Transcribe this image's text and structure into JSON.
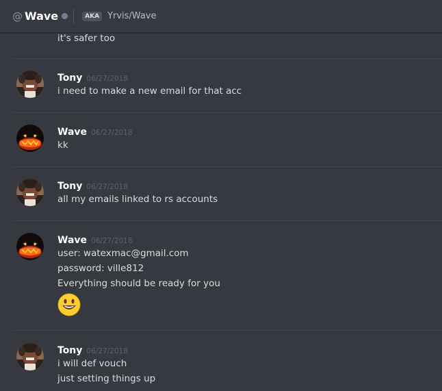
{
  "header": {
    "at": "@",
    "username": "Wave",
    "aka_badge": "AKA",
    "aka_names": "Yrvis/Wave"
  },
  "continuation": {
    "text": "it's safer too"
  },
  "messages": [
    {
      "author": "Tony",
      "timestamp": "06/27/2018",
      "lines": [
        "i need to make a new email for that acc"
      ],
      "avatar": "tony-avatar"
    },
    {
      "author": "Wave",
      "timestamp": "06/27/2018",
      "lines": [
        "kk"
      ],
      "avatar": "wave-avatar"
    },
    {
      "author": "Tony",
      "timestamp": "06/27/2018",
      "lines": [
        "all my emails linked to rs accounts"
      ],
      "avatar": "tony-avatar"
    },
    {
      "author": "Wave",
      "timestamp": "06/27/2018",
      "lines": [
        "user: watexmac@gmail.com",
        "password: ville812",
        "Everything should be ready for you"
      ],
      "emoji": "smiley-emoji",
      "avatar": "wave-avatar"
    },
    {
      "author": "Tony",
      "timestamp": "06/27/2018",
      "lines": [
        "i will def vouch",
        "just setting things up"
      ],
      "avatar": "tony-avatar"
    }
  ],
  "colors": {
    "background": "#36393f",
    "author": "#ffffff",
    "text": "#dcddde",
    "timestamp": "#5d6066",
    "divider": "#42454a",
    "status_offline": "#747f8d"
  }
}
